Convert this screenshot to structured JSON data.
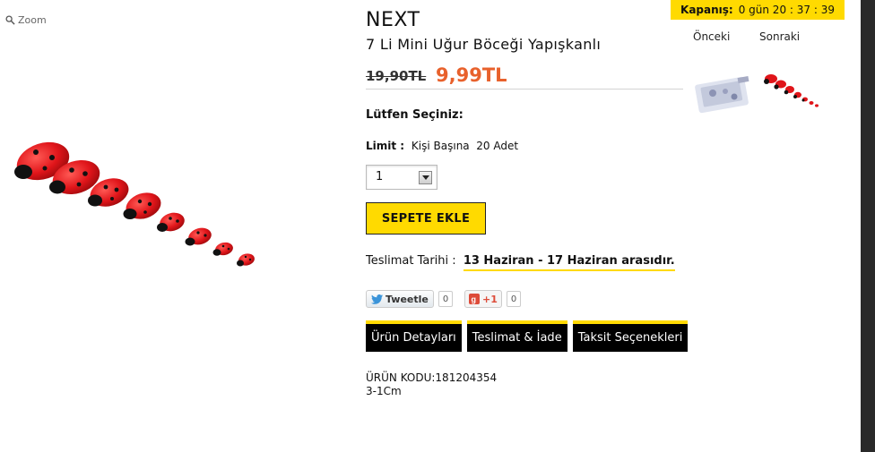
{
  "zoom": {
    "label": "Zoom",
    "icon": "magnifier-icon"
  },
  "product": {
    "brand": "NEXT",
    "title": "7 Li Mini Uğur Böceği Yapışkanlı",
    "old_price": "19,90TL",
    "new_price": "9,99TL",
    "select_label": "Lütfen Seçiniz:",
    "limit_label": "Limit :",
    "limit_value": "Kişi Başına  20 Adet",
    "quantity": "1",
    "add_to_cart": "SEPETE EKLE",
    "delivery_label": "Teslimat Tarihi :",
    "delivery_date": "13 Haziran - 17 Haziran arasıdır.",
    "code_line": "ÜRÜN KODU:181204354",
    "size_line": "3-1Cm"
  },
  "social": {
    "tweet_label": "Tweetle",
    "tweet_count": "0",
    "gplus_label": "+1",
    "gplus_count": "0"
  },
  "tabs": [
    {
      "label": "Ürün Detayları"
    },
    {
      "label": "Teslimat & İade"
    },
    {
      "label": "Taksit Seçenekleri"
    }
  ],
  "countdown": {
    "label": "Kapanış:",
    "value": "0 gün 20 : 37 : 39"
  },
  "nav": {
    "prev": "Önceki",
    "next": "Sonraki"
  },
  "colors": {
    "accent_yellow": "#ffda00",
    "price_orange": "#e8612c",
    "ladybug_red": "#e0151a"
  }
}
